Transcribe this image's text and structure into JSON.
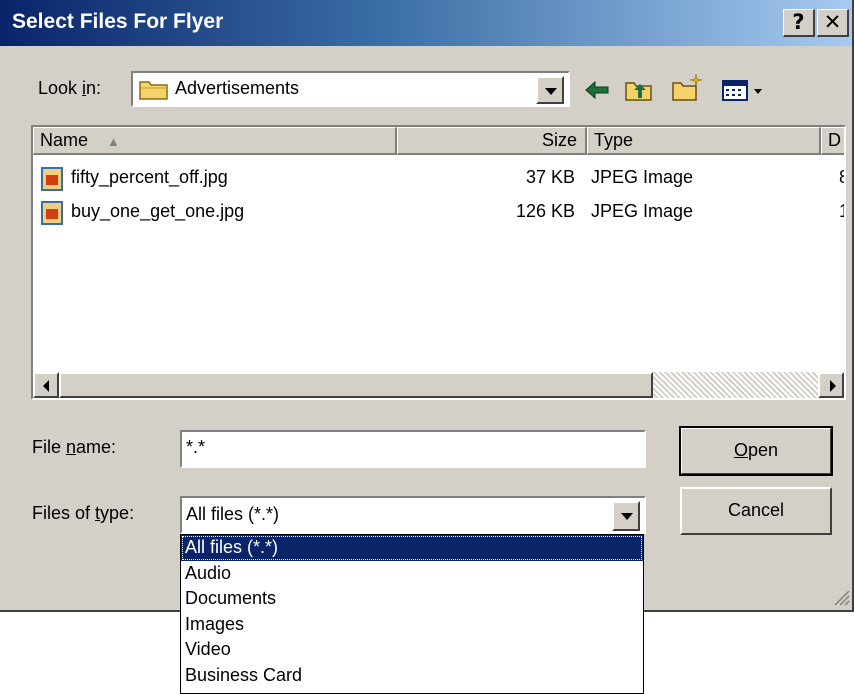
{
  "window": {
    "title": "Select Files For Flyer",
    "help_label": "?",
    "close_label": "✕"
  },
  "look_in": {
    "label_prefix": "Look ",
    "label_access": "i",
    "label_suffix": "n:",
    "value": "Advertisements"
  },
  "toolbar": {
    "back_icon": "back-arrow-icon",
    "up_icon": "up-folder-icon",
    "new_folder_icon": "new-folder-icon",
    "view_icon": "view-menu-icon"
  },
  "file_list": {
    "columns": [
      "Name",
      "Size",
      "Type",
      "D"
    ],
    "sort_indicator": "▲",
    "rows": [
      {
        "name": "fifty_percent_off.jpg",
        "size": "37 KB",
        "type": "JPEG Image",
        "date": "8"
      },
      {
        "name": "buy_one_get_one.jpg",
        "size": "126 KB",
        "type": "JPEG Image",
        "date": "1"
      }
    ]
  },
  "file_name": {
    "label_prefix": "File ",
    "label_access": "n",
    "label_suffix": "ame:",
    "value": "*.*"
  },
  "files_of_type": {
    "label_prefix": "Files of ",
    "label_access": "t",
    "label_suffix": "ype:",
    "selected": "All files (*.*)",
    "options": [
      "All files (*.*)",
      "Audio",
      "Documents",
      "Images",
      "Video",
      "Business Card"
    ]
  },
  "buttons": {
    "open_access": "O",
    "open_rest": "pen",
    "cancel": "Cancel"
  },
  "colors": {
    "title_start": "#0a246a",
    "title_end": "#a6caf0",
    "face": "#d4d0c8",
    "selection": "#0a246a"
  }
}
